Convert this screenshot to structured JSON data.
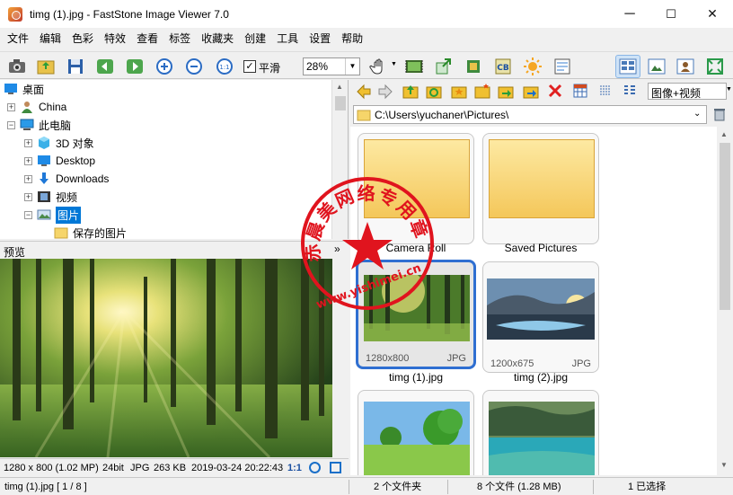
{
  "window": {
    "title": "timg (1).jpg  -  FastStone Image Viewer 7.0",
    "minimize": "─",
    "maximize": "☐",
    "close": "✕"
  },
  "menu": [
    "文件",
    "编辑",
    "色彩",
    "特效",
    "查看",
    "标签",
    "收藏夹",
    "创建",
    "工具",
    "设置",
    "帮助"
  ],
  "toolbar": {
    "smooth_label": "平滑",
    "smooth_checked": true,
    "zoom_value": "28%",
    "icons": [
      "camera-icon",
      "open-folder-icon",
      "save-icon",
      "previous-icon",
      "next-icon",
      "zoom-in-icon",
      "zoom-out-icon",
      "actual-size-icon",
      "hand-icon",
      "slideshow-icon",
      "export-icon",
      "crop-icon",
      "contact-sheet-icon",
      "brightness-icon",
      "batch-icon",
      "layout-browser-icon",
      "layout-preview-icon",
      "layout-person-icon",
      "fullscreen-icon"
    ]
  },
  "tree": {
    "items": [
      {
        "label": "桌面",
        "icon": "desktop-icon",
        "expander": ""
      },
      {
        "label": "China",
        "icon": "user-icon",
        "expander": "+"
      },
      {
        "label": "此电脑",
        "icon": "computer-icon",
        "expander": "−"
      },
      {
        "label": "3D 对象",
        "icon": "cube-icon",
        "expander": "+"
      },
      {
        "label": "Desktop",
        "icon": "desktop-icon",
        "expander": "+"
      },
      {
        "label": "Downloads",
        "icon": "download-icon",
        "expander": "+"
      },
      {
        "label": "视频",
        "icon": "film-icon",
        "expander": "+"
      },
      {
        "label": "图片",
        "icon": "picture-icon",
        "expander": "−",
        "selected": true
      },
      {
        "label": "保存的图片",
        "icon": "folder-icon",
        "expander": ""
      }
    ]
  },
  "preview": {
    "header": "预览",
    "collapse": "»",
    "info": {
      "dimensions": "1280 x 800 (1.02 MP)",
      "bits": "24bit",
      "format": "JPG",
      "size": "263 KB",
      "date": "2019-03-24 20:22:43",
      "ratio": "1:1"
    }
  },
  "nav": {
    "view_mode": "图像+视频",
    "path": "C:\\Users\\yuchaner\\Pictures\\"
  },
  "thumbnails": [
    {
      "name": "Camera Roll",
      "type": "folder"
    },
    {
      "name": "Saved Pictures",
      "type": "folder"
    },
    {
      "name": "timg (1).jpg",
      "type": "image",
      "res": "1280x800",
      "fmt": "JPG",
      "selected": true
    },
    {
      "name": "timg (2).jpg",
      "type": "image",
      "res": "1200x675",
      "fmt": "JPG"
    },
    {
      "name": "",
      "type": "image"
    },
    {
      "name": "",
      "type": "image"
    }
  ],
  "status": {
    "file": "timg (1).jpg [ 1 / 8 ]",
    "folders": "2 个文件夹",
    "files": "8 个文件 (1.28 MB)",
    "selected": "1 已选择"
  },
  "watermark": {
    "text": "赤晨美网络专用章",
    "url": "www.yishimei.cn"
  },
  "colors": {
    "selection": "#2f6fd1",
    "tree_selected": "#0078d7",
    "stamp": "#e0141e"
  }
}
